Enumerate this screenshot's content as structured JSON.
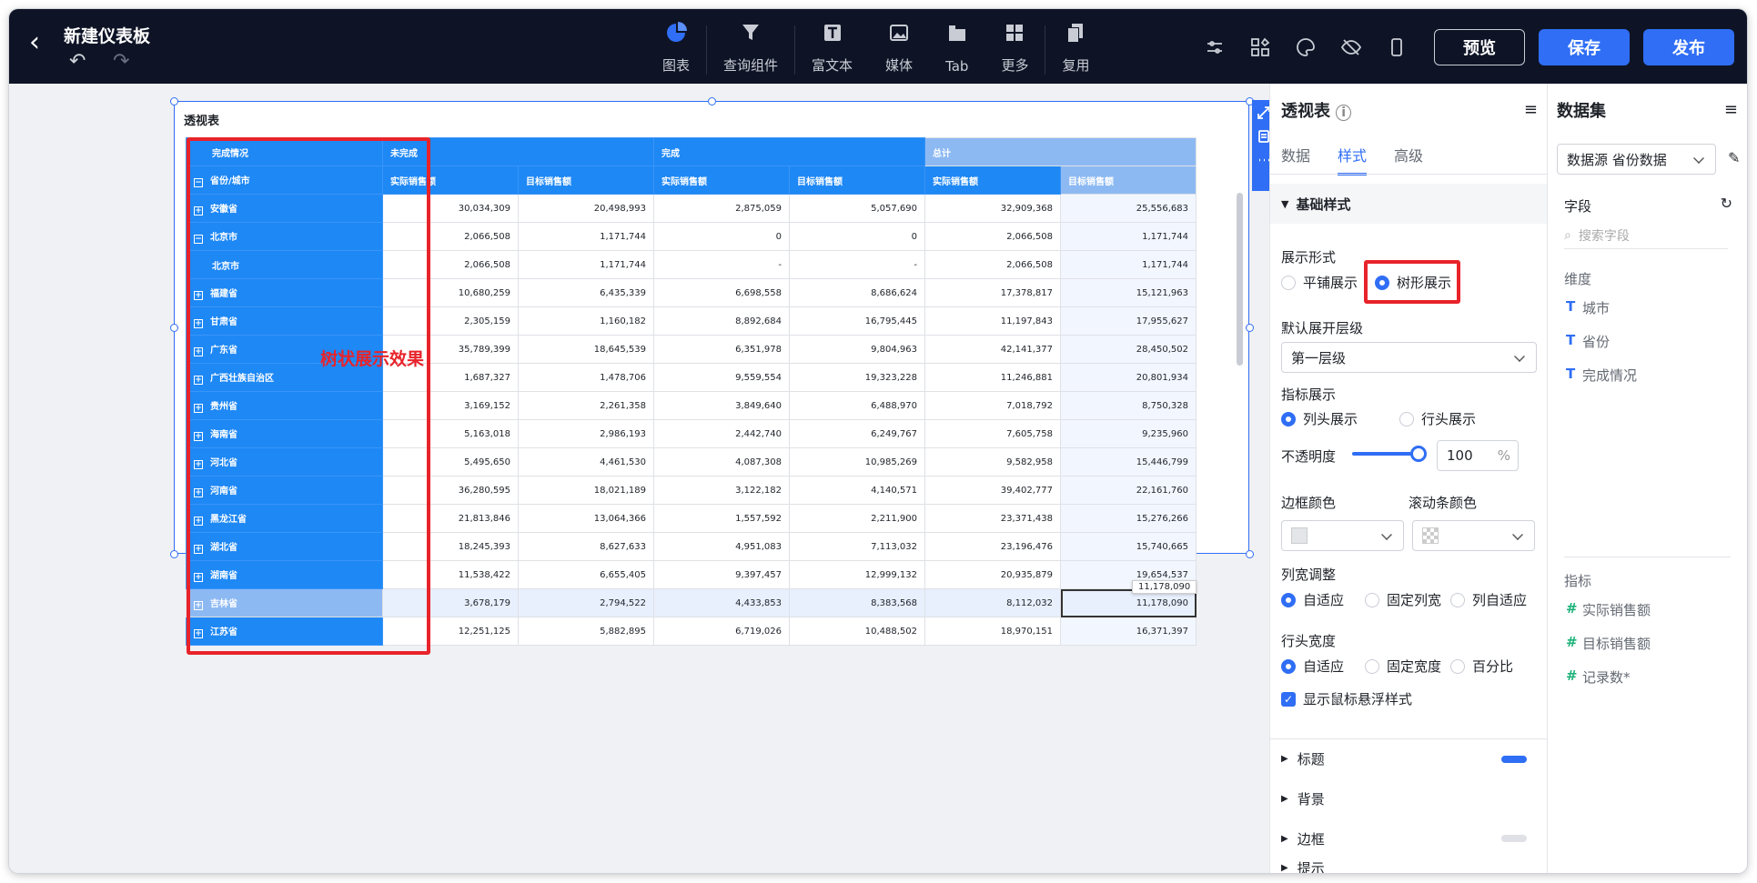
{
  "header": {
    "back_icon": "back-arrow-icon",
    "title": "新建仪表板",
    "undo_icon": "undo-icon",
    "redo_icon": "redo-icon",
    "tools": [
      {
        "label": "图表",
        "icon": "chart-icon",
        "active": true
      },
      {
        "label": "查询组件",
        "icon": "filter-icon"
      },
      {
        "label": "富文本",
        "icon": "text-icon"
      },
      {
        "label": "媒体",
        "icon": "image-icon"
      },
      {
        "label": "Tab",
        "icon": "tab-icon"
      },
      {
        "label": "更多",
        "icon": "grid-icon"
      },
      {
        "label": "复用",
        "icon": "copy-icon"
      }
    ],
    "preview": "预览",
    "save": "保存",
    "publish": "发布"
  },
  "widget": {
    "title": "透视表",
    "annotation": "树状展示效果",
    "tooltip": "11,178,090",
    "col_groups": [
      "完成情况",
      "未完成",
      "完成",
      "总计"
    ],
    "row_header_label": "省份/城市",
    "metric_labels": [
      "实际销售额",
      "目标销售额",
      "实际销售额",
      "目标销售额",
      "实际销售额",
      "目标销售额"
    ],
    "rows": [
      {
        "name": "安徽省",
        "sym": "+",
        "v": [
          "30,034,309",
          "20,498,993",
          "2,875,059",
          "5,057,690",
          "32,909,368",
          "25,556,683"
        ]
      },
      {
        "name": "北京市",
        "sym": "−",
        "v": [
          "2,066,508",
          "1,171,744",
          "0",
          "0",
          "2,066,508",
          "1,171,744"
        ]
      },
      {
        "name": "北京市",
        "sym": "",
        "v": [
          "2,066,508",
          "1,171,744",
          "-",
          "-",
          "2,066,508",
          "1,171,744"
        ]
      },
      {
        "name": "福建省",
        "sym": "+",
        "v": [
          "10,680,259",
          "6,435,339",
          "6,698,558",
          "8,686,624",
          "17,378,817",
          "15,121,963"
        ]
      },
      {
        "name": "甘肃省",
        "sym": "+",
        "v": [
          "2,305,159",
          "1,160,182",
          "8,892,684",
          "16,795,445",
          "11,197,843",
          "17,955,627"
        ]
      },
      {
        "name": "广东省",
        "sym": "+",
        "v": [
          "35,789,399",
          "18,645,539",
          "6,351,978",
          "9,804,963",
          "42,141,377",
          "28,450,502"
        ]
      },
      {
        "name": "广西壮族自治区",
        "sym": "+",
        "v": [
          "1,687,327",
          "1,478,706",
          "9,559,554",
          "19,323,228",
          "11,246,881",
          "20,801,934"
        ]
      },
      {
        "name": "贵州省",
        "sym": "+",
        "v": [
          "3,169,152",
          "2,261,358",
          "3,849,640",
          "6,488,970",
          "7,018,792",
          "8,750,328"
        ]
      },
      {
        "name": "海南省",
        "sym": "+",
        "v": [
          "5,163,018",
          "2,986,193",
          "2,442,740",
          "6,249,767",
          "7,605,758",
          "9,235,960"
        ]
      },
      {
        "name": "河北省",
        "sym": "+",
        "v": [
          "5,495,650",
          "4,461,530",
          "4,087,308",
          "10,985,269",
          "9,582,958",
          "15,446,799"
        ]
      },
      {
        "name": "河南省",
        "sym": "+",
        "v": [
          "36,280,595",
          "18,021,189",
          "3,122,182",
          "4,140,571",
          "39,402,777",
          "22,161,760"
        ]
      },
      {
        "name": "黑龙江省",
        "sym": "+",
        "v": [
          "21,813,846",
          "13,064,366",
          "1,557,592",
          "2,211,900",
          "23,371,438",
          "15,276,266"
        ]
      },
      {
        "name": "湖北省",
        "sym": "+",
        "v": [
          "18,245,393",
          "8,627,633",
          "4,951,083",
          "7,113,032",
          "23,196,476",
          "15,740,665"
        ]
      },
      {
        "name": "湖南省",
        "sym": "+",
        "v": [
          "11,538,422",
          "6,655,405",
          "9,397,457",
          "12,999,132",
          "20,935,879",
          "19,654,537"
        ]
      },
      {
        "name": "吉林省",
        "sym": "+",
        "hl": true,
        "v": [
          "3,678,179",
          "2,794,522",
          "4,433,853",
          "8,383,568",
          "8,112,032",
          "11,178,090"
        ]
      },
      {
        "name": "江苏省",
        "sym": "+",
        "v": [
          "12,251,125",
          "5,882,895",
          "6,719,026",
          "10,488,502",
          "18,970,151",
          "16,371,397"
        ]
      }
    ]
  },
  "style_panel": {
    "title": "透视表",
    "info_icon": "info-icon",
    "menu_icon": "menu-icon",
    "tabs": [
      "数据",
      "样式",
      "高级"
    ],
    "basic": "基础样式",
    "display_mode": "展示形式",
    "mode_tile": "平铺展示",
    "mode_tree": "树形展示",
    "expand_level": "默认展开层级",
    "expand_value": "第一层级",
    "metric_display": "指标展示",
    "metric_col": "列头展示",
    "metric_row": "行头展示",
    "opacity": "不透明度",
    "opacity_value": "100",
    "opacity_unit": "%",
    "opacity_level": 1.0,
    "border_color": "边框颜色",
    "scroll_color": "滚动条颜色",
    "col_width": "列宽调整",
    "cw_auto": "自适应",
    "cw_fixed": "固定列宽",
    "cw_col": "列自适应",
    "row_width": "行头宽度",
    "rw_auto": "自适应",
    "rw_fixed": "固定宽度",
    "rw_pct": "百分比",
    "hover": "显示鼠标悬浮样式",
    "sections": [
      "标题",
      "背景",
      "边框",
      "提示"
    ]
  },
  "data_panel": {
    "title": "数据集",
    "dataset": "数据源 省份数据",
    "fields": "字段",
    "search_placeholder": "搜索字段",
    "dimension": "维度",
    "dims": [
      "城市",
      "省份",
      "完成情况"
    ],
    "metric": "指标",
    "metrics": [
      "实际销售额",
      "目标销售额",
      "记录数*"
    ]
  },
  "colors": {
    "accent": "#2f6ef5",
    "header_blue": "#1e88f5",
    "annotation_red": "#e8232a"
  }
}
